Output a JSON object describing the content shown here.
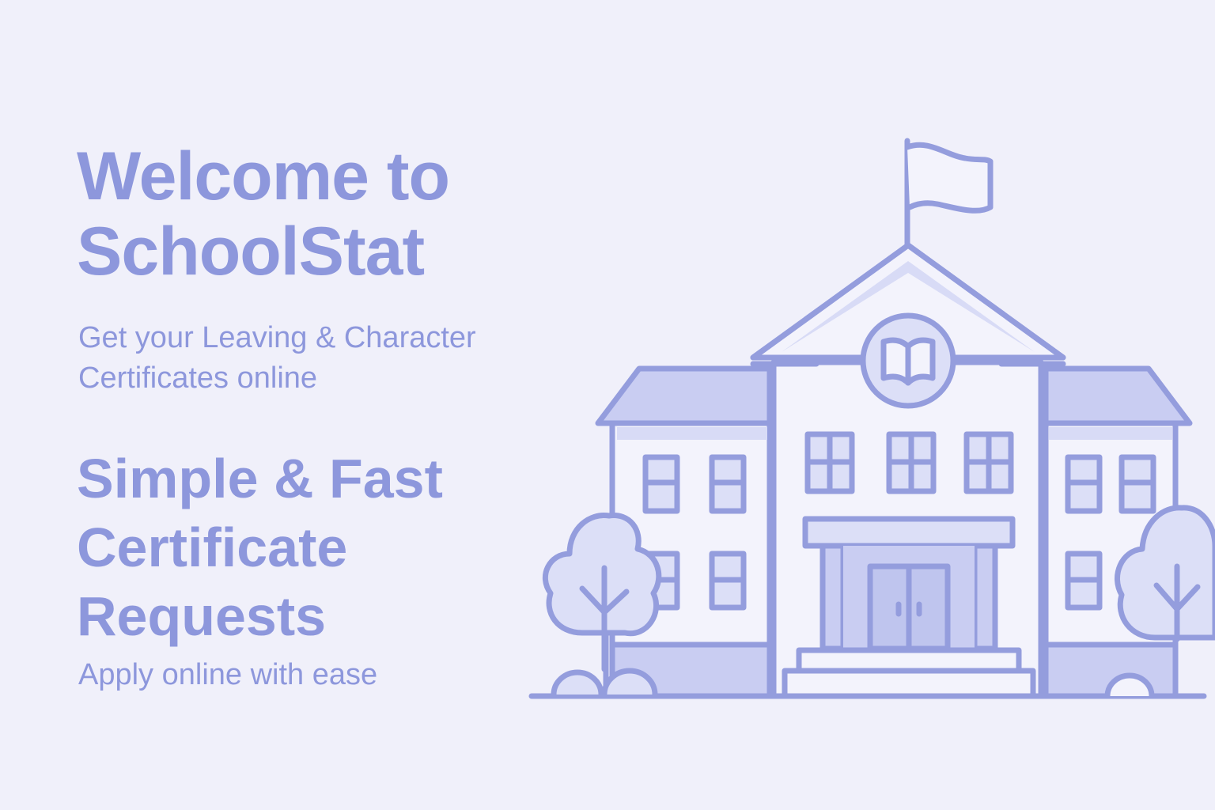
{
  "hero": {
    "title": "Welcome to\nSchoolStat",
    "subtitle": "Get your Leaving & Character\nCertificates online",
    "feature_title": "Simple & Fast\nCertificate\nRequests",
    "feature_subtitle": "Apply online with ease"
  },
  "illustration": {
    "name": "school-building-illustration",
    "icons": [
      "school-building",
      "flag",
      "open-book-emblem",
      "tree-left",
      "tree-right"
    ]
  },
  "colors": {
    "background": "#f0f0fa",
    "accent": "#8d97dc",
    "fill_light": "#dcdff7",
    "fill_mid": "#c3c8f0",
    "fill_white": "#f3f3fc"
  }
}
